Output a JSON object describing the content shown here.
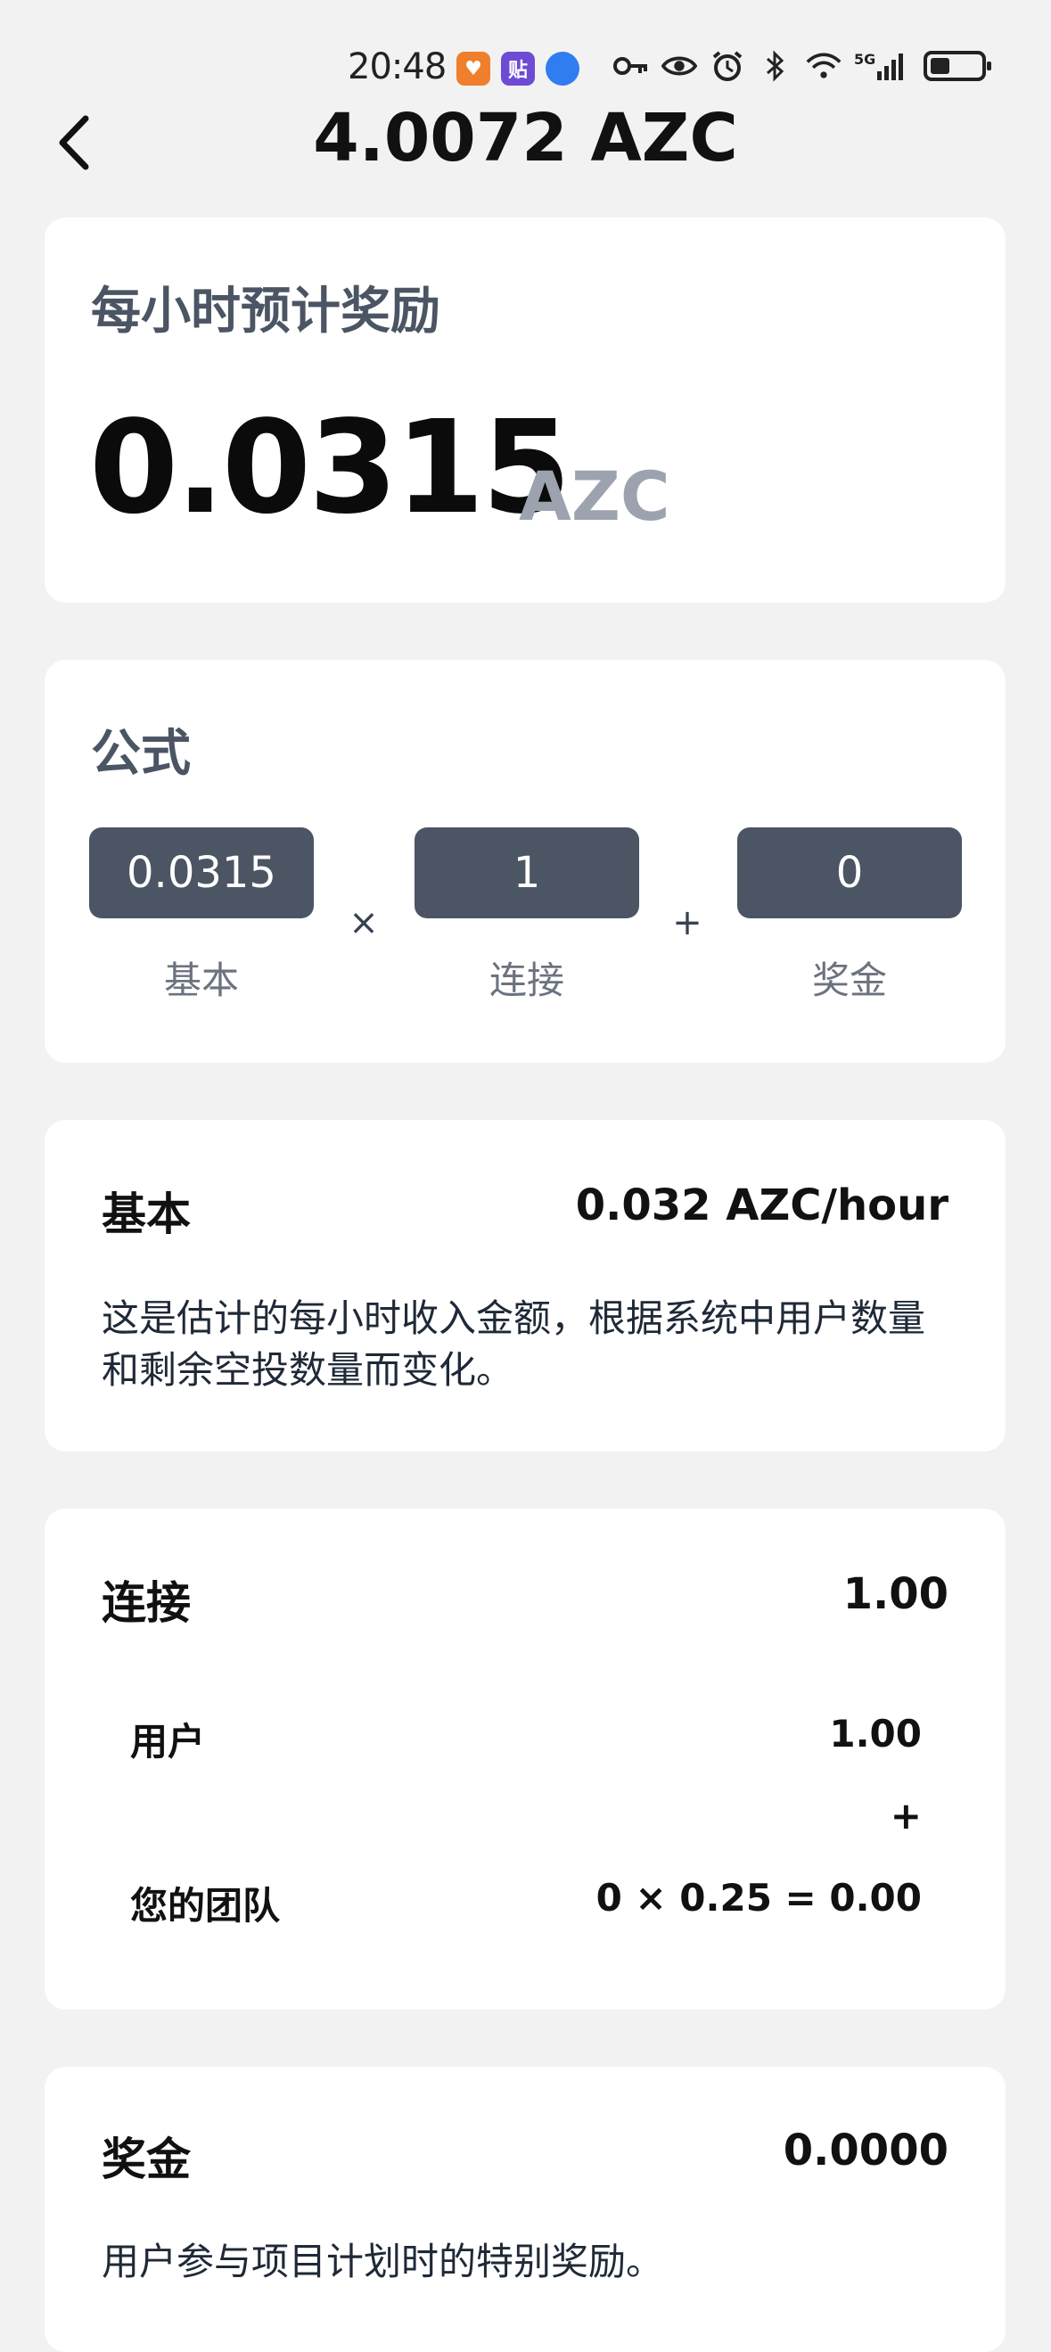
{
  "status_bar": {
    "time": "20:48",
    "app_icons": [
      "heart-app-icon",
      "tie-app-icon",
      "planet-app-icon"
    ],
    "app_icon_glyphs": [
      "♥",
      "贴",
      "●"
    ],
    "indicators": [
      "key-icon",
      "eye-icon",
      "alarm-icon",
      "bluetooth-icon",
      "wifi-icon",
      "5g-signal-icon"
    ],
    "battery_level": 0.34
  },
  "header": {
    "title": "4.0072 AZC"
  },
  "reward_card": {
    "label": "每小时预计奖励",
    "value": "0.0315",
    "unit": "AZC"
  },
  "formula_card": {
    "title": "公式",
    "terms": [
      {
        "value": "0.0315",
        "label": "基本"
      },
      {
        "value": "1",
        "label": "连接"
      },
      {
        "value": "0",
        "label": "奖金"
      }
    ],
    "operators": [
      "×",
      "+"
    ]
  },
  "base_card": {
    "title": "基本",
    "value": "0.032 AZC/hour",
    "description": "这是估计的每小时收入金额，根据系统中用户数量和剩余空投数量而变化。"
  },
  "connection_card": {
    "title": "连接",
    "value": "1.00",
    "user_label": "用户",
    "user_value": "1.00",
    "plus": "+",
    "team_label": "您的团队",
    "team_value": "0 × 0.25 = 0.00"
  },
  "bonus_card": {
    "title": "奖金",
    "value": "0.0000",
    "description": "用户参与项目计划时的特别奖励。"
  },
  "colors": {
    "background": "#f2f2f2",
    "card": "#ffffff",
    "formula_box": "#4b5563",
    "muted_text": "#9ca3af"
  }
}
